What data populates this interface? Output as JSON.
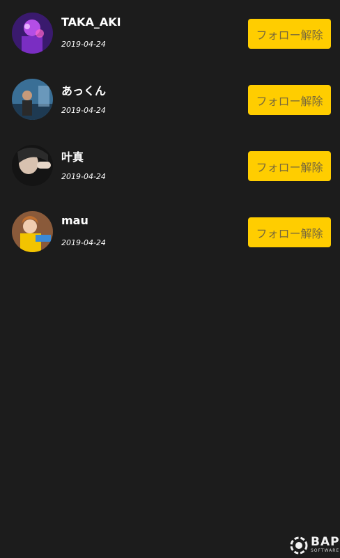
{
  "follow_list": [
    {
      "name": "TAKA_AKI",
      "date": "2019-04-24",
      "button_label": "フォロー解除"
    },
    {
      "name": "あっくん",
      "date": "2019-04-24",
      "button_label": "フォロー解除"
    },
    {
      "name": "叶真",
      "date": "2019-04-24",
      "button_label": "フォロー解除"
    },
    {
      "name": "mau",
      "date": "2019-04-24",
      "button_label": "フォロー解除"
    }
  ],
  "brand": {
    "name": "BAP",
    "sub": "SOFTWARE"
  },
  "colors": {
    "background": "#1c1c1c",
    "button": "#ffcd00",
    "button_text": "#7a6a3a"
  }
}
